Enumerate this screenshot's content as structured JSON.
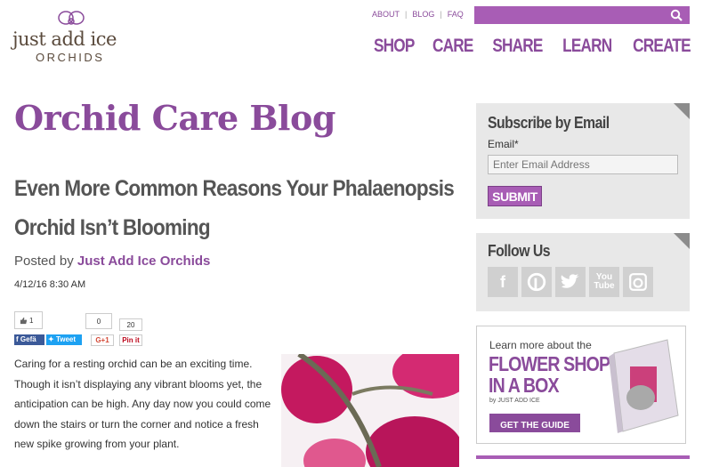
{
  "logo": {
    "line1": "just add ice",
    "line2": "ORCHIDS"
  },
  "toplinks": [
    "ABOUT",
    "BLOG",
    "FAQ"
  ],
  "nav": [
    "SHOP",
    "CARE",
    "SHARE",
    "LEARN",
    "CREATE"
  ],
  "blog_title": "Orchid Care Blog",
  "post": {
    "title_line1": "Even More Common Reasons Your Phalaenopsis",
    "title_line2": "Orchid Isn’t Blooming",
    "posted_prefix": "Posted by ",
    "author": "Just Add Ice Orchids",
    "date": "4/12/16 8:30 AM",
    "body": "Caring for a resting orchid can be an exciting time. Though it isn’t displaying any vibrant blooms yet, the anticipation can be high. Any day now you could come down the stairs or turn the corner and notice a fresh new spike growing from your plant."
  },
  "share": {
    "fb_count": "1",
    "fb_label": "Gefä",
    "tw_label": "Tweet",
    "gplus_count": "0",
    "gplus_label": "G+1",
    "pin_count": "20",
    "pin_label": "Pin it"
  },
  "subscribe": {
    "title": "Subscribe by Email",
    "email_label": "Email*",
    "placeholder": "Enter Email Address",
    "submit": "SUBMIT"
  },
  "follow": {
    "title": "Follow Us"
  },
  "promo": {
    "learn": "Learn more about the",
    "line1": "FLOWER SHOP",
    "line2": "IN A BOX",
    "by": "by JUST ADD ICE",
    "cta": "GET THE GUIDE"
  },
  "colors": {
    "brand": "#8a4b9b",
    "brand_light": "#a85db5",
    "sidebar_bg": "#e8e8e8"
  }
}
